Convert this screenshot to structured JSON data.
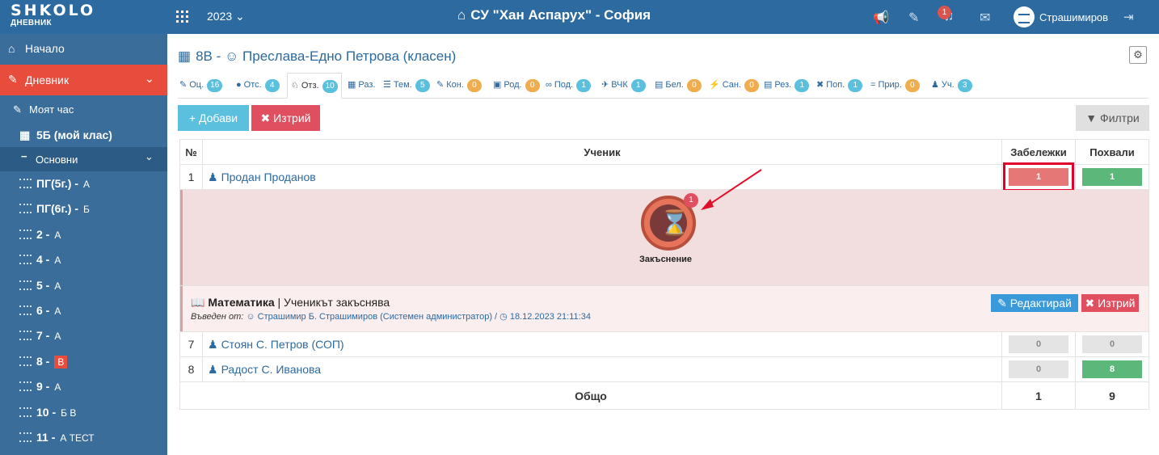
{
  "topbar": {
    "logo": "SHKOLO",
    "logo_sub": "ДНЕВНИК",
    "year": "2023 ⌄",
    "school": "СУ \"Хан Аспарух\" - София",
    "notifications_count": "1",
    "user": "Страшимиров"
  },
  "sidebar": {
    "home": "Начало",
    "diary": "Дневник",
    "my_hour": "Моят час",
    "my_class": "5Б (мой клас)",
    "section": "Основни",
    "classes": [
      {
        "name": "ПГ(5г.) -",
        "divs": "А"
      },
      {
        "name": "ПГ(6г.) -",
        "divs": "Б"
      },
      {
        "name": "2 -",
        "divs": "А"
      },
      {
        "name": "4 -",
        "divs": "А"
      },
      {
        "name": "5 -",
        "divs": "А"
      },
      {
        "name": "6 -",
        "divs": "А"
      },
      {
        "name": "7 -",
        "divs": "А"
      },
      {
        "name": "8 -",
        "divs": "В"
      },
      {
        "name": "9 -",
        "divs": "А"
      },
      {
        "name": "10 -",
        "divs": "Б  В"
      },
      {
        "name": "11 -",
        "divs": "А  ТЕСТ"
      }
    ]
  },
  "page": {
    "title": "8В - ☺ Преслава-Едно Петрова (класен)"
  },
  "tabs": [
    {
      "label": "Оц.",
      "count": "16",
      "icon": "✎",
      "color": "teal"
    },
    {
      "label": "Отс.",
      "count": "4",
      "icon": "●",
      "color": "teal"
    },
    {
      "label": "Отз.",
      "count": "10",
      "icon": "♘",
      "color": "teal"
    },
    {
      "label": "Раз.",
      "count": "",
      "icon": "▦",
      "color": ""
    },
    {
      "label": "Тем.",
      "count": "5",
      "icon": "☰",
      "color": "teal"
    },
    {
      "label": "Кон.",
      "count": "0",
      "icon": "✎",
      "color": "yel"
    },
    {
      "label": "Род.",
      "count": "0",
      "icon": "▣",
      "color": "yel"
    },
    {
      "label": "Под.",
      "count": "1",
      "icon": "∞",
      "color": "teal"
    },
    {
      "label": "ВЧК",
      "count": "1",
      "icon": "✈",
      "color": "teal"
    },
    {
      "label": "Бел.",
      "count": "0",
      "icon": "▤",
      "color": "yel"
    },
    {
      "label": "Сан.",
      "count": "0",
      "icon": "⚡",
      "color": "yel"
    },
    {
      "label": "Рез.",
      "count": "1",
      "icon": "▤",
      "color": "teal"
    },
    {
      "label": "Поп.",
      "count": "1",
      "icon": "✖",
      "color": "teal"
    },
    {
      "label": "Прир.",
      "count": "0",
      "icon": "=",
      "color": "yel"
    },
    {
      "label": "Уч.",
      "count": "3",
      "icon": "♟",
      "color": "teal"
    }
  ],
  "actions": {
    "add": "Добави",
    "delete": "Изтрий",
    "filters": "Филтри"
  },
  "table": {
    "headers": [
      "№",
      "Ученик",
      "Забележки",
      "Похвали"
    ],
    "rows": [
      {
        "num": "1",
        "name": "Продан Проданов",
        "notes": "1",
        "praises": "1"
      },
      {
        "num": "7",
        "name": "Стоян С. Петров (СОП)",
        "notes": "0",
        "praises": "0"
      },
      {
        "num": "8",
        "name": "Радост С. Иванова",
        "notes": "0",
        "praises": "8"
      }
    ],
    "detail": {
      "badge_label": "Закъснение",
      "badge_count": "1",
      "subject": "Математика",
      "note": "Ученикът закъснява",
      "entered_by_label": "Въведен от:",
      "entered_by": "☺ Страшимир Б. Страшимиров (Системен администратор) /",
      "timestamp": "◷ 18.12.2023 21:11:34",
      "edit": "Редактирай",
      "delete": "Изтрий"
    },
    "total": {
      "label": "Общо",
      "notes": "1",
      "praises": "9"
    }
  },
  "colors": {
    "topbar": "#2c6aa0",
    "sidebar": "#3a6d99",
    "active": "#e74c3c",
    "highlight": "#e0002a"
  }
}
